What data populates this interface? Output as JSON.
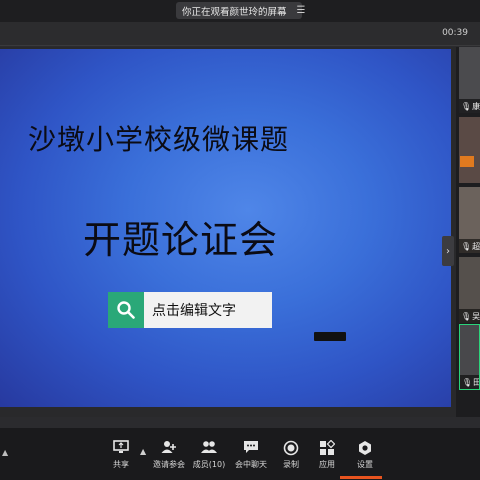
{
  "share_banner": {
    "text": "你正在观看颜世玲的屏幕",
    "menu_icon": "list-icon"
  },
  "meeting": {
    "elapsed": "00:39"
  },
  "slide": {
    "title_line1": "沙墩小学校级微课题",
    "title_line2": "开题论证会",
    "edit_button_label": "点击编辑文字",
    "edit_icon": "search-icon",
    "accent_color": "#2aa878"
  },
  "participants": [
    {
      "label": "康",
      "mic": "mic-icon"
    },
    {
      "label": "",
      "mic": ""
    },
    {
      "label": "超",
      "mic": "mic-icon"
    },
    {
      "label": "吴",
      "mic": "mic-icon"
    },
    {
      "label": "田",
      "mic": "mic-icon"
    }
  ],
  "toolbar": {
    "share": "共享",
    "invite": "邀请参会",
    "members": "成员(10)",
    "chat": "会中聊天",
    "record": "录制",
    "apps": "应用",
    "settings": "设置"
  },
  "colors": {
    "toolbar_bg": "#1a1a1c",
    "active_border": "#2bd47a",
    "highlight": "#e8541f"
  }
}
